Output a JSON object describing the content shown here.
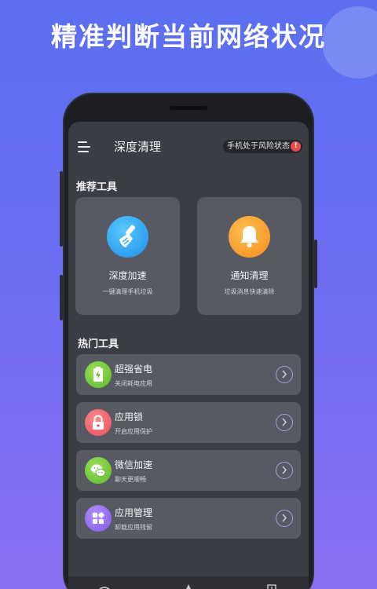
{
  "headline": "精准判断当前网络状况",
  "app": {
    "title": "深度清理",
    "risk_badge": "手机处于风险状态",
    "risk_badge_mark": "!"
  },
  "recommended": {
    "title": "推荐工具",
    "cards": [
      {
        "title": "深度加速",
        "subtitle": "一键清理手机垃圾",
        "icon": "broom-icon",
        "color": "#2a9cf0"
      },
      {
        "title": "通知清理",
        "subtitle": "垃圾消息快速清除",
        "icon": "bell-icon",
        "color": "#f5a030"
      }
    ]
  },
  "hot": {
    "title": "热门工具",
    "items": [
      {
        "title": "超强省电",
        "subtitle": "关闭耗电应用",
        "icon": "battery-icon",
        "color": "#6cc73a"
      },
      {
        "title": "应用锁",
        "subtitle": "开启应用保护",
        "icon": "lock-icon",
        "color": "#f0606a"
      },
      {
        "title": "微信加速",
        "subtitle": "聊天更顺畅",
        "icon": "wechat-icon",
        "color": "#6cc73a"
      },
      {
        "title": "应用管理",
        "subtitle": "卸载应用残留",
        "icon": "apps-grid-icon",
        "color": "#9068f0"
      }
    ]
  },
  "bottom_nav": [
    "wifi-icon",
    "rocket-icon",
    "toolbox-icon"
  ],
  "colors": {
    "background_gradient_start": "#5b6ff0",
    "background_gradient_end": "#8a6ff0",
    "screen_bg": "#3a3d44",
    "card_bg": "#575a62",
    "risk_red": "#e94949"
  }
}
